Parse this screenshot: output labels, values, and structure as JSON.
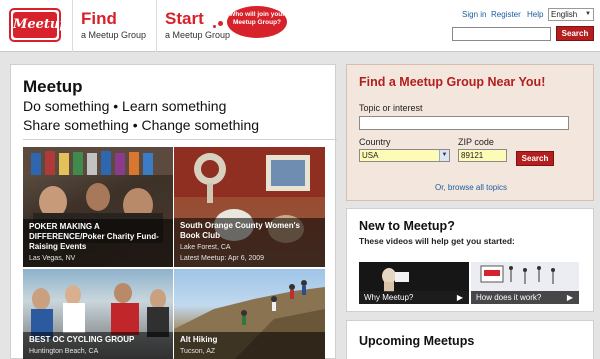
{
  "header": {
    "logo_text": "Meetup",
    "find": {
      "title": "Find",
      "subtitle": "a Meetup Group"
    },
    "start": {
      "title": "Start",
      "subtitle": "a Meetup Group"
    },
    "bubble": "Who will join your Meetup Group?",
    "links": {
      "signin": "Sign in",
      "register": "Register",
      "help": "Help"
    },
    "language": "English",
    "search_button": "Search"
  },
  "hero": {
    "title": "Meetup",
    "line1": "Do something • Learn something",
    "line2": "Share something • Change something"
  },
  "tiles": [
    {
      "title": "POKER MAKING A DIFFERENCE/Poker Charity Fund-Raising Events",
      "location": "Las Vegas, NV"
    },
    {
      "title": "South Orange County Women's Book Club",
      "location": "Lake Forest, CA",
      "extra": "Latest Meetup: Apr 6, 2009"
    },
    {
      "title": "BEST OC CYCLING GROUP",
      "location": "Huntington Beach, CA"
    },
    {
      "title": "Alt Hiking",
      "location": "Tucson, AZ"
    }
  ],
  "find_panel": {
    "title": "Find a Meetup Group Near You!",
    "topic_label": "Topic or interest",
    "topic_value": "",
    "country_label": "Country",
    "country_value": "USA",
    "zip_label": "ZIP code",
    "zip_value": "89121",
    "search_button": "Search",
    "browse_link": "Or, browse all topics"
  },
  "new_panel": {
    "title": "New to Meetup?",
    "subtitle": "These videos will help get you started:",
    "video1": "Why Meetup?",
    "video2": "How does it work?"
  },
  "upcoming": {
    "title": "Upcoming Meetups"
  },
  "colors": {
    "brand_red": "#d8222b",
    "link_blue": "#1b5ea1",
    "find_bg": "#f3e6dc"
  }
}
